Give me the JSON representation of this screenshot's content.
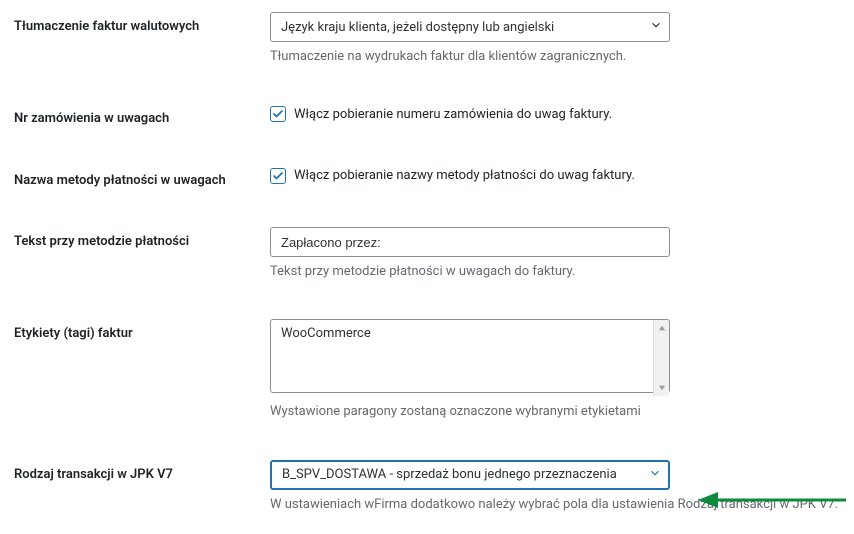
{
  "rows": {
    "translation": {
      "label": "Tłumaczenie faktur walutowych",
      "selected": "Język kraju klienta, jeżeli dostępny lub angielski",
      "description": "Tłumaczenie na wydrukach faktur dla klientów zagranicznych."
    },
    "orderNumber": {
      "label": "Nr zamówienia w uwagach",
      "checkboxLabel": "Włącz pobieranie numeru zamówienia do uwag faktury."
    },
    "paymentName": {
      "label": "Nazwa metody płatności w uwagach",
      "checkboxLabel": "Włącz pobieranie nazwy metody płatności do uwag faktury."
    },
    "paymentText": {
      "label": "Tekst przy metodzie płatności",
      "value": "Zapłacono przez:",
      "description": "Tekst przy metodzie płatności w uwagach do faktury."
    },
    "tags": {
      "label": "Etykiety (tagi) faktur",
      "value": "WooCommerce",
      "description": "Wystawione paragony zostaną oznaczone wybranymi etykietami"
    },
    "transactionType": {
      "label": "Rodzaj transakcji w JPK V7",
      "selected": "B_SPV_DOSTAWA - sprzedaż bonu jednego przeznaczenia",
      "description": "W ustawieniach wFirma dodatkowo należy wybrać pola dla ustawienia Rodzaj transakcji w JPK V7."
    }
  }
}
